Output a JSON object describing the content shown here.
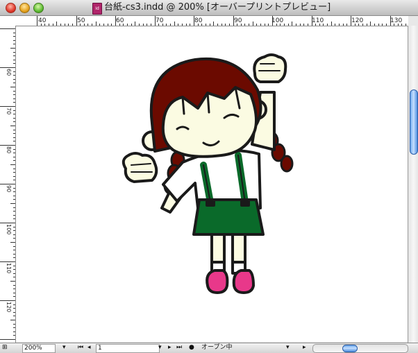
{
  "window": {
    "title": "台紙-cs3.indd @ 200% [オーバープリントプレビュー]",
    "doc_icon_label": "Id",
    "colors": {
      "accent": "#3a7fd6",
      "close": "#e0392c",
      "minimize": "#e6a21d",
      "maximize": "#5fbd34"
    }
  },
  "ruler_h": {
    "ticks": [
      "40",
      "50",
      "60",
      "70",
      "80",
      "90",
      "100",
      "110",
      "120",
      "130"
    ]
  },
  "ruler_v": {
    "ticks": [
      "60",
      "70",
      "80",
      "90",
      "100",
      "110",
      "120"
    ]
  },
  "illustration": {
    "colors": {
      "hair": "#6b0a00",
      "skin": "#fbfbe2",
      "skirt": "#0a6a2a",
      "shoes": "#e8388a",
      "outline": "#1a1a1a",
      "shirt": "#ffffff"
    }
  },
  "statusbar": {
    "zoom": "200%",
    "page": "1",
    "status": "オープン中"
  }
}
